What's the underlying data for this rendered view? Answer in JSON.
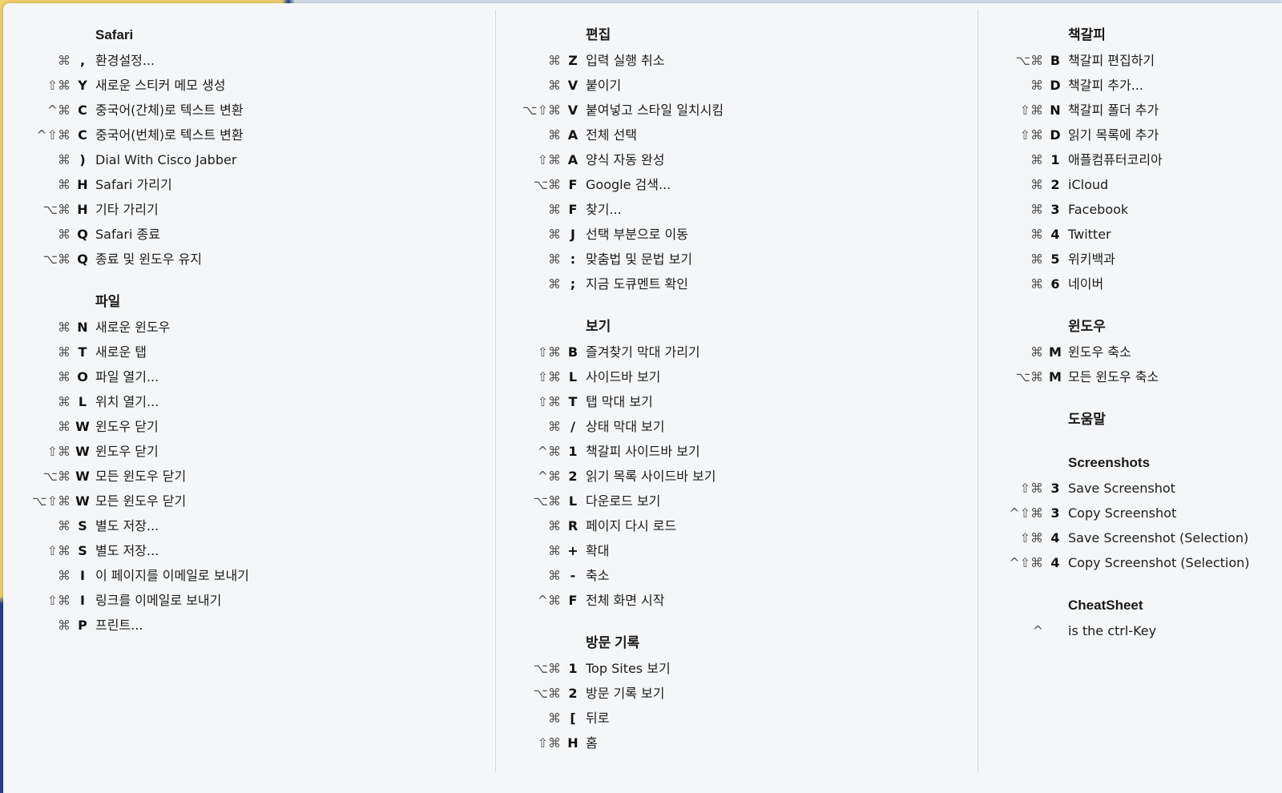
{
  "columns": [
    {
      "sections": [
        {
          "title": "Safari",
          "items": [
            {
              "mods": "⌘",
              "key": ",",
              "label": "환경설정..."
            },
            {
              "mods": "⇧⌘",
              "key": "Y",
              "label": "새로운 스티커 메모 생성"
            },
            {
              "mods": "^⌘",
              "key": "C",
              "label": "중국어(간체)로 텍스트 변환"
            },
            {
              "mods": "^⇧⌘",
              "key": "C",
              "label": "중국어(번체)로 텍스트 변환"
            },
            {
              "mods": "⌘",
              "key": ")",
              "label": "Dial With Cisco Jabber"
            },
            {
              "mods": "⌘",
              "key": "H",
              "label": "Safari 가리기"
            },
            {
              "mods": "⌥⌘",
              "key": "H",
              "label": "기타 가리기"
            },
            {
              "mods": "⌘",
              "key": "Q",
              "label": "Safari 종료"
            },
            {
              "mods": "⌥⌘",
              "key": "Q",
              "label": "종료 및 윈도우 유지"
            }
          ]
        },
        {
          "title": "파일",
          "items": [
            {
              "mods": "⌘",
              "key": "N",
              "label": "새로운 윈도우"
            },
            {
              "mods": "⌘",
              "key": "T",
              "label": "새로운 탭"
            },
            {
              "mods": "⌘",
              "key": "O",
              "label": "파일 열기..."
            },
            {
              "mods": "⌘",
              "key": "L",
              "label": "위치 열기..."
            },
            {
              "mods": "⌘",
              "key": "W",
              "label": "윈도우 닫기"
            },
            {
              "mods": "⇧⌘",
              "key": "W",
              "label": "윈도우 닫기"
            },
            {
              "mods": "⌥⌘",
              "key": "W",
              "label": "모든 윈도우 닫기"
            },
            {
              "mods": "⌥⇧⌘",
              "key": "W",
              "label": "모든 윈도우 닫기"
            },
            {
              "mods": "⌘",
              "key": "S",
              "label": "별도 저장..."
            },
            {
              "mods": "⇧⌘",
              "key": "S",
              "label": "별도 저장..."
            },
            {
              "mods": "⌘",
              "key": "I",
              "label": "이 페이지를 이메일로 보내기"
            },
            {
              "mods": "⇧⌘",
              "key": "I",
              "label": "링크를 이메일로 보내기"
            },
            {
              "mods": "⌘",
              "key": "P",
              "label": "프린트..."
            }
          ]
        }
      ]
    },
    {
      "sections": [
        {
          "title": "편집",
          "items": [
            {
              "mods": "⌘",
              "key": "Z",
              "label": "입력 실행 취소"
            },
            {
              "mods": "⌘",
              "key": "V",
              "label": "붙이기"
            },
            {
              "mods": "⌥⇧⌘",
              "key": "V",
              "label": "붙여넣고 스타일 일치시킴"
            },
            {
              "mods": "⌘",
              "key": "A",
              "label": "전체 선택"
            },
            {
              "mods": "⇧⌘",
              "key": "A",
              "label": "양식 자동 완성"
            },
            {
              "mods": "⌥⌘",
              "key": "F",
              "label": "Google 검색..."
            },
            {
              "mods": "⌘",
              "key": "F",
              "label": "찾기..."
            },
            {
              "mods": "⌘",
              "key": "J",
              "label": "선택 부분으로 이동"
            },
            {
              "mods": "⌘",
              "key": ":",
              "label": "맞춤법 및 문법 보기"
            },
            {
              "mods": "⌘",
              "key": ";",
              "label": "지금 도큐멘트 확인"
            }
          ]
        },
        {
          "title": "보기",
          "items": [
            {
              "mods": "⇧⌘",
              "key": "B",
              "label": "즐겨찾기 막대 가리기"
            },
            {
              "mods": "⇧⌘",
              "key": "L",
              "label": "사이드바 보기"
            },
            {
              "mods": "⇧⌘",
              "key": "T",
              "label": "탭 막대 보기"
            },
            {
              "mods": "⌘",
              "key": "/",
              "label": "상태 막대 보기"
            },
            {
              "mods": "^⌘",
              "key": "1",
              "label": "책갈피 사이드바 보기"
            },
            {
              "mods": "^⌘",
              "key": "2",
              "label": "읽기 목록 사이드바 보기"
            },
            {
              "mods": "⌥⌘",
              "key": "L",
              "label": "다운로드 보기"
            },
            {
              "mods": "⌘",
              "key": "R",
              "label": "페이지 다시 로드"
            },
            {
              "mods": "⌘",
              "key": "+",
              "label": "확대"
            },
            {
              "mods": "⌘",
              "key": "-",
              "label": "축소"
            },
            {
              "mods": "^⌘",
              "key": "F",
              "label": "전체 화면 시작"
            }
          ]
        },
        {
          "title": "방문 기록",
          "items": [
            {
              "mods": "⌥⌘",
              "key": "1",
              "label": "Top Sites 보기"
            },
            {
              "mods": "⌥⌘",
              "key": "2",
              "label": "방문 기록 보기"
            },
            {
              "mods": "⌘",
              "key": "[",
              "label": "뒤로"
            },
            {
              "mods": "⇧⌘",
              "key": "H",
              "label": "홈"
            }
          ]
        }
      ]
    },
    {
      "sections": [
        {
          "title": "책갈피",
          "items": [
            {
              "mods": "⌥⌘",
              "key": "B",
              "label": "책갈피 편집하기"
            },
            {
              "mods": "⌘",
              "key": "D",
              "label": "책갈피 추가..."
            },
            {
              "mods": "⇧⌘",
              "key": "N",
              "label": "책갈피 폴더 추가"
            },
            {
              "mods": "⇧⌘",
              "key": "D",
              "label": "읽기 목록에 추가"
            },
            {
              "mods": "⌘",
              "key": "1",
              "label": "애플컴퓨터코리아"
            },
            {
              "mods": "⌘",
              "key": "2",
              "label": "iCloud"
            },
            {
              "mods": "⌘",
              "key": "3",
              "label": "Facebook"
            },
            {
              "mods": "⌘",
              "key": "4",
              "label": "Twitter"
            },
            {
              "mods": "⌘",
              "key": "5",
              "label": "위키백과"
            },
            {
              "mods": "⌘",
              "key": "6",
              "label": "네이버"
            }
          ]
        },
        {
          "title": "윈도우",
          "items": [
            {
              "mods": "⌘",
              "key": "M",
              "label": "윈도우 축소"
            },
            {
              "mods": "⌥⌘",
              "key": "M",
              "label": "모든 윈도우 축소"
            }
          ]
        },
        {
          "title": "도움말",
          "items": []
        },
        {
          "title": "Screenshots",
          "items": [
            {
              "mods": "⇧⌘",
              "key": "3",
              "label": "Save Screenshot"
            },
            {
              "mods": "^⇧⌘",
              "key": "3",
              "label": "Copy Screenshot"
            },
            {
              "mods": "⇧⌘",
              "key": "4",
              "label": "Save Screenshot (Selection)"
            },
            {
              "mods": "^⇧⌘",
              "key": "4",
              "label": "Copy Screenshot (Selection)"
            }
          ]
        },
        {
          "title": "CheatSheet",
          "items": [
            {
              "mods": "^",
              "key": "",
              "label": "is the ctrl-Key"
            }
          ]
        }
      ]
    }
  ]
}
